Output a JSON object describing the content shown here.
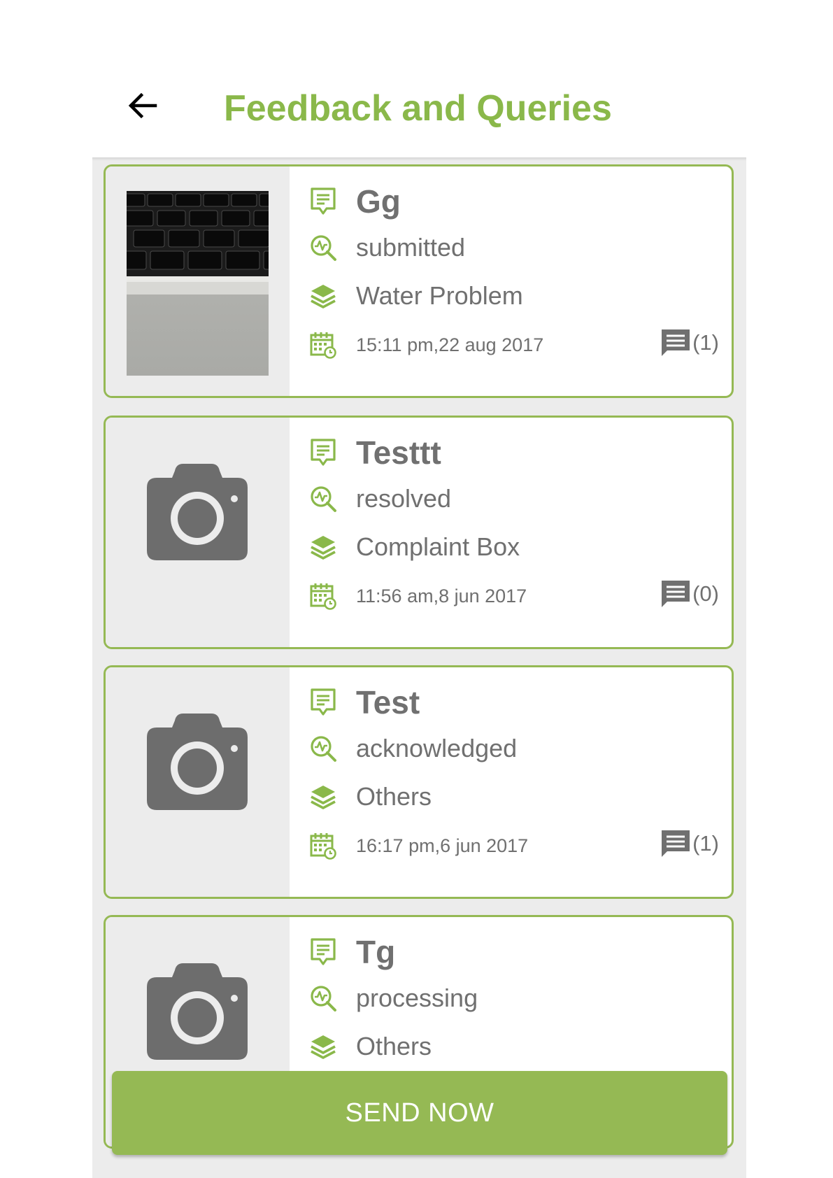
{
  "header": {
    "title": "Feedback and Queries"
  },
  "colors": {
    "accent": "#95b954",
    "title": "#8ab84a",
    "text": "#707070",
    "list_bg": "#ececec"
  },
  "items": [
    {
      "name": "Gg",
      "status": "submitted",
      "category": "Water Problem",
      "datetime": "15:11 pm,22 aug 2017",
      "comments": "(1)",
      "has_photo": true
    },
    {
      "name": "Testtt",
      "status": "resolved",
      "category": "Complaint Box",
      "datetime": "11:56 am,8 jun 2017",
      "comments": "(0)",
      "has_photo": false
    },
    {
      "name": "Test",
      "status": "acknowledged",
      "category": "Others",
      "datetime": "16:17 pm,6 jun 2017",
      "comments": "(1)",
      "has_photo": false
    },
    {
      "name": "Tg",
      "status": "processing",
      "category": "Others",
      "datetime": "",
      "comments": "",
      "has_photo": false
    }
  ],
  "actions": {
    "send_label": "SEND NOW"
  }
}
